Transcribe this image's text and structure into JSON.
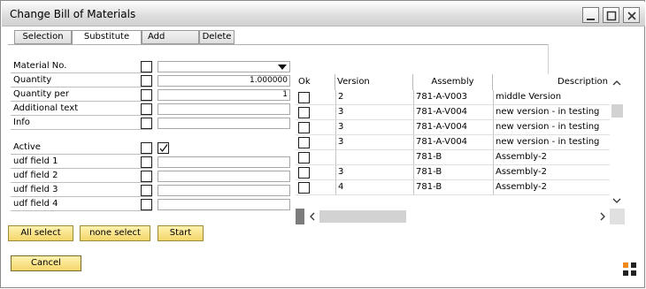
{
  "window": {
    "title": "Change Bill of Materials"
  },
  "tabs": [
    {
      "label": "Selection"
    },
    {
      "label": "Substitute"
    },
    {
      "label": "Add"
    },
    {
      "label": "Delete"
    }
  ],
  "form": {
    "material_no": {
      "label": "Material No.",
      "value": ""
    },
    "quantity": {
      "label": "Quantity",
      "value": "1.000000"
    },
    "quantity_per": {
      "label": "Quantity per",
      "value": "1"
    },
    "additional_text": {
      "label": "Additional text",
      "value": ""
    },
    "info": {
      "label": "Info",
      "value": ""
    },
    "active": {
      "label": "Active",
      "checked": true
    },
    "udf1": {
      "label": "udf field 1",
      "value": ""
    },
    "udf2": {
      "label": "udf field 2",
      "value": ""
    },
    "udf3": {
      "label": "udf field 3",
      "value": ""
    },
    "udf4": {
      "label": "udf field 4",
      "value": ""
    }
  },
  "grid": {
    "headers": {
      "ok": "Ok",
      "version": "Version",
      "assembly": "Assembly",
      "description": "Description"
    },
    "rows": [
      {
        "version": "2",
        "assembly": "781-A-V003",
        "description": "middle Version"
      },
      {
        "version": "3",
        "assembly": "781-A-V004",
        "description": "new version - in testing"
      },
      {
        "version": "3",
        "assembly": "781-A-V004",
        "description": "new version - in testing"
      },
      {
        "version": "3",
        "assembly": "781-A-V004",
        "description": "new version - in testing"
      },
      {
        "version": "",
        "assembly": "781-B",
        "description": "Assembly-2"
      },
      {
        "version": "3",
        "assembly": "781-B",
        "description": "Assembly-2"
      },
      {
        "version": "4",
        "assembly": "781-B",
        "description": "Assembly-2"
      }
    ]
  },
  "buttons": {
    "all_select": "All select",
    "none_select": "none select",
    "start": "Start",
    "cancel": "Cancel"
  },
  "colors": {
    "button_fill": "#f3d56a",
    "titlebar": "#dcdcdc"
  }
}
